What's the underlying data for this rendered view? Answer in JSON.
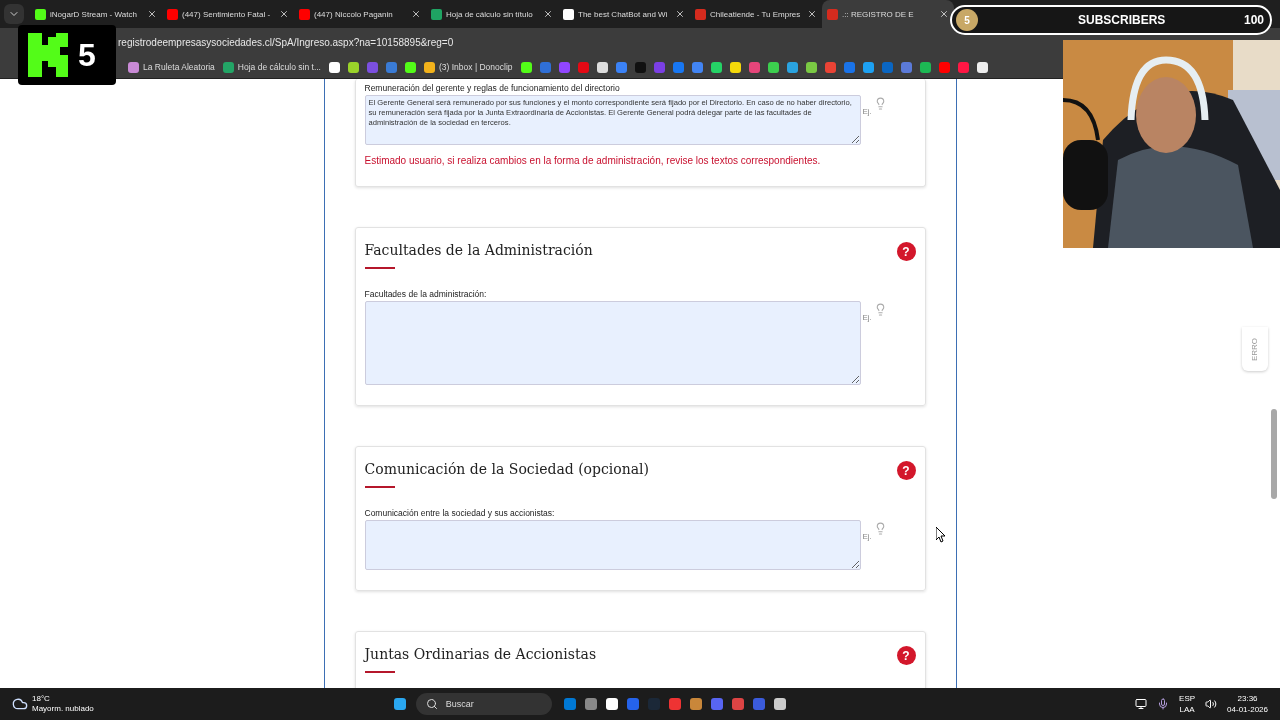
{
  "tabs": [
    {
      "kind": "kick",
      "title": "iNogarD Stream - Watch",
      "selected": false
    },
    {
      "kind": "youtube",
      "title": "(447) Sentimiento Fatal -",
      "selected": false
    },
    {
      "kind": "youtube",
      "title": "(447) Niccolo Paganin",
      "selected": false
    },
    {
      "kind": "sheets",
      "title": "Hoja de cálculo sin título",
      "selected": false
    },
    {
      "kind": "chat",
      "title": "The best ChatBot and Wi",
      "selected": false
    },
    {
      "kind": "flag",
      "title": "Chileatiende - Tu Empres",
      "selected": false
    },
    {
      "kind": "flag",
      "title": ".:: REGISTRO DE E",
      "selected": true
    }
  ],
  "address": "registrodeempresasysociedades.cl/SpA/Ingreso.aspx?na=10158895&reg=0",
  "bookmarks": [
    {
      "label": "La Ruleta Aleatoria",
      "color": "#c98ad6"
    },
    {
      "label": "Hoja de cálculo sin t...",
      "color": "#23a566"
    },
    {
      "color": "#ffffff"
    },
    {
      "color": "#9ad32a"
    },
    {
      "color": "#7b4fe0"
    },
    {
      "color": "#3a7bd5"
    },
    {
      "color": "#53fc18"
    },
    {
      "label": "(3) Inbox | Donoclip",
      "color": "#f2b21b"
    },
    {
      "color": "#53fc18"
    },
    {
      "color": "#2f6fd6"
    },
    {
      "color": "#9146ff"
    },
    {
      "color": "#e50914"
    },
    {
      "color": "#dddddd"
    },
    {
      "color": "#3b82f6"
    },
    {
      "color": "#111111"
    },
    {
      "color": "#7b3fe4"
    },
    {
      "color": "#1877f2"
    },
    {
      "color": "#4285f4"
    },
    {
      "color": "#25d366"
    },
    {
      "color": "#f5d90a"
    },
    {
      "color": "#e6457a"
    },
    {
      "color": "#3ccf4e"
    },
    {
      "color": "#2aa3e0"
    },
    {
      "color": "#7ac943"
    },
    {
      "color": "#ea4335"
    },
    {
      "color": "#1a73e8"
    },
    {
      "color": "#1da1f2"
    },
    {
      "color": "#0a66c2"
    },
    {
      "color": "#5b7ad8"
    },
    {
      "color": "#1db954"
    },
    {
      "color": "#ff0000"
    },
    {
      "color": "#ff1744"
    },
    {
      "color": "#eeeeee"
    }
  ],
  "overlay": {
    "logo_digit": "5",
    "sub_count": "5",
    "sub_label": "SUBSCRIBERS",
    "sub_goal": "100"
  },
  "side_tab": "ERRO",
  "intro": {
    "label": "Remuneración del gerente y reglas de funcionamiento del directorio",
    "value": "El Gerente General será remunerado por sus funciones y el monto correspondiente será fijado por el Directorio. En caso de no haber directorio, su remuneración será fijada por la Junta Extraordinaria de Accionistas. El Gerente General podrá delegar parte de las facultades de administración de la sociedad en terceros.",
    "hint": "Ej.",
    "warning": "Estimado usuario, si realiza cambios en la forma de administración, revise los textos correspondientes."
  },
  "sections": [
    {
      "title": "Facultades de la Administración",
      "help": "?",
      "label": "Facultades de la administración:",
      "hint": "Ej."
    },
    {
      "title": "Comunicación de la Sociedad (opcional)",
      "help": "?",
      "label": "Comunicación entre la sociedad y sus accionistas:",
      "hint": "Ej."
    },
    {
      "title": "Juntas Ordinarias de Accionistas",
      "help": "?"
    }
  ],
  "taskbar": {
    "temperature": "18°C",
    "weather": "Mayorm. nublado",
    "search": "Buscar",
    "lang": "ESP",
    "layout": "LAA",
    "time": "23:36",
    "date": "04-01-2026"
  }
}
